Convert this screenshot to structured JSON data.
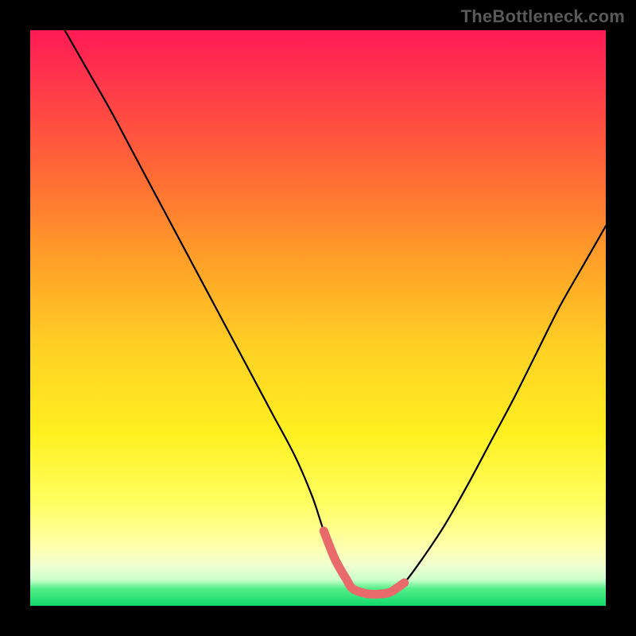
{
  "watermark": "TheBottleneck.com",
  "chart_data": {
    "type": "line",
    "title": "",
    "xlabel": "",
    "ylabel": "",
    "xlim": [
      0,
      100
    ],
    "ylim": [
      0,
      100
    ],
    "grid": false,
    "series": [
      {
        "name": "bottleneck-curve",
        "color": "#000000",
        "x": [
          6,
          10,
          14,
          18,
          22,
          26,
          30,
          34,
          38,
          42,
          46,
          49,
          51,
          53,
          55,
          56,
          58,
          60,
          62,
          63,
          65,
          68,
          72,
          76,
          80,
          84,
          88,
          92,
          96,
          100
        ],
        "y": [
          100,
          93,
          86,
          78.5,
          71,
          63.5,
          56,
          48.5,
          41,
          33.5,
          26,
          19,
          13,
          8,
          4.5,
          3,
          2.2,
          2,
          2.2,
          2.6,
          4,
          8,
          14,
          21,
          28.5,
          36,
          44,
          52,
          59,
          66
        ]
      },
      {
        "name": "bottom-highlight",
        "color": "#e86a6a",
        "thick": true,
        "x": [
          51,
          53,
          55,
          56,
          58,
          60,
          62,
          63,
          65
        ],
        "y": [
          13,
          8,
          4.5,
          3,
          2.2,
          2,
          2.2,
          2.6,
          4
        ]
      }
    ]
  }
}
